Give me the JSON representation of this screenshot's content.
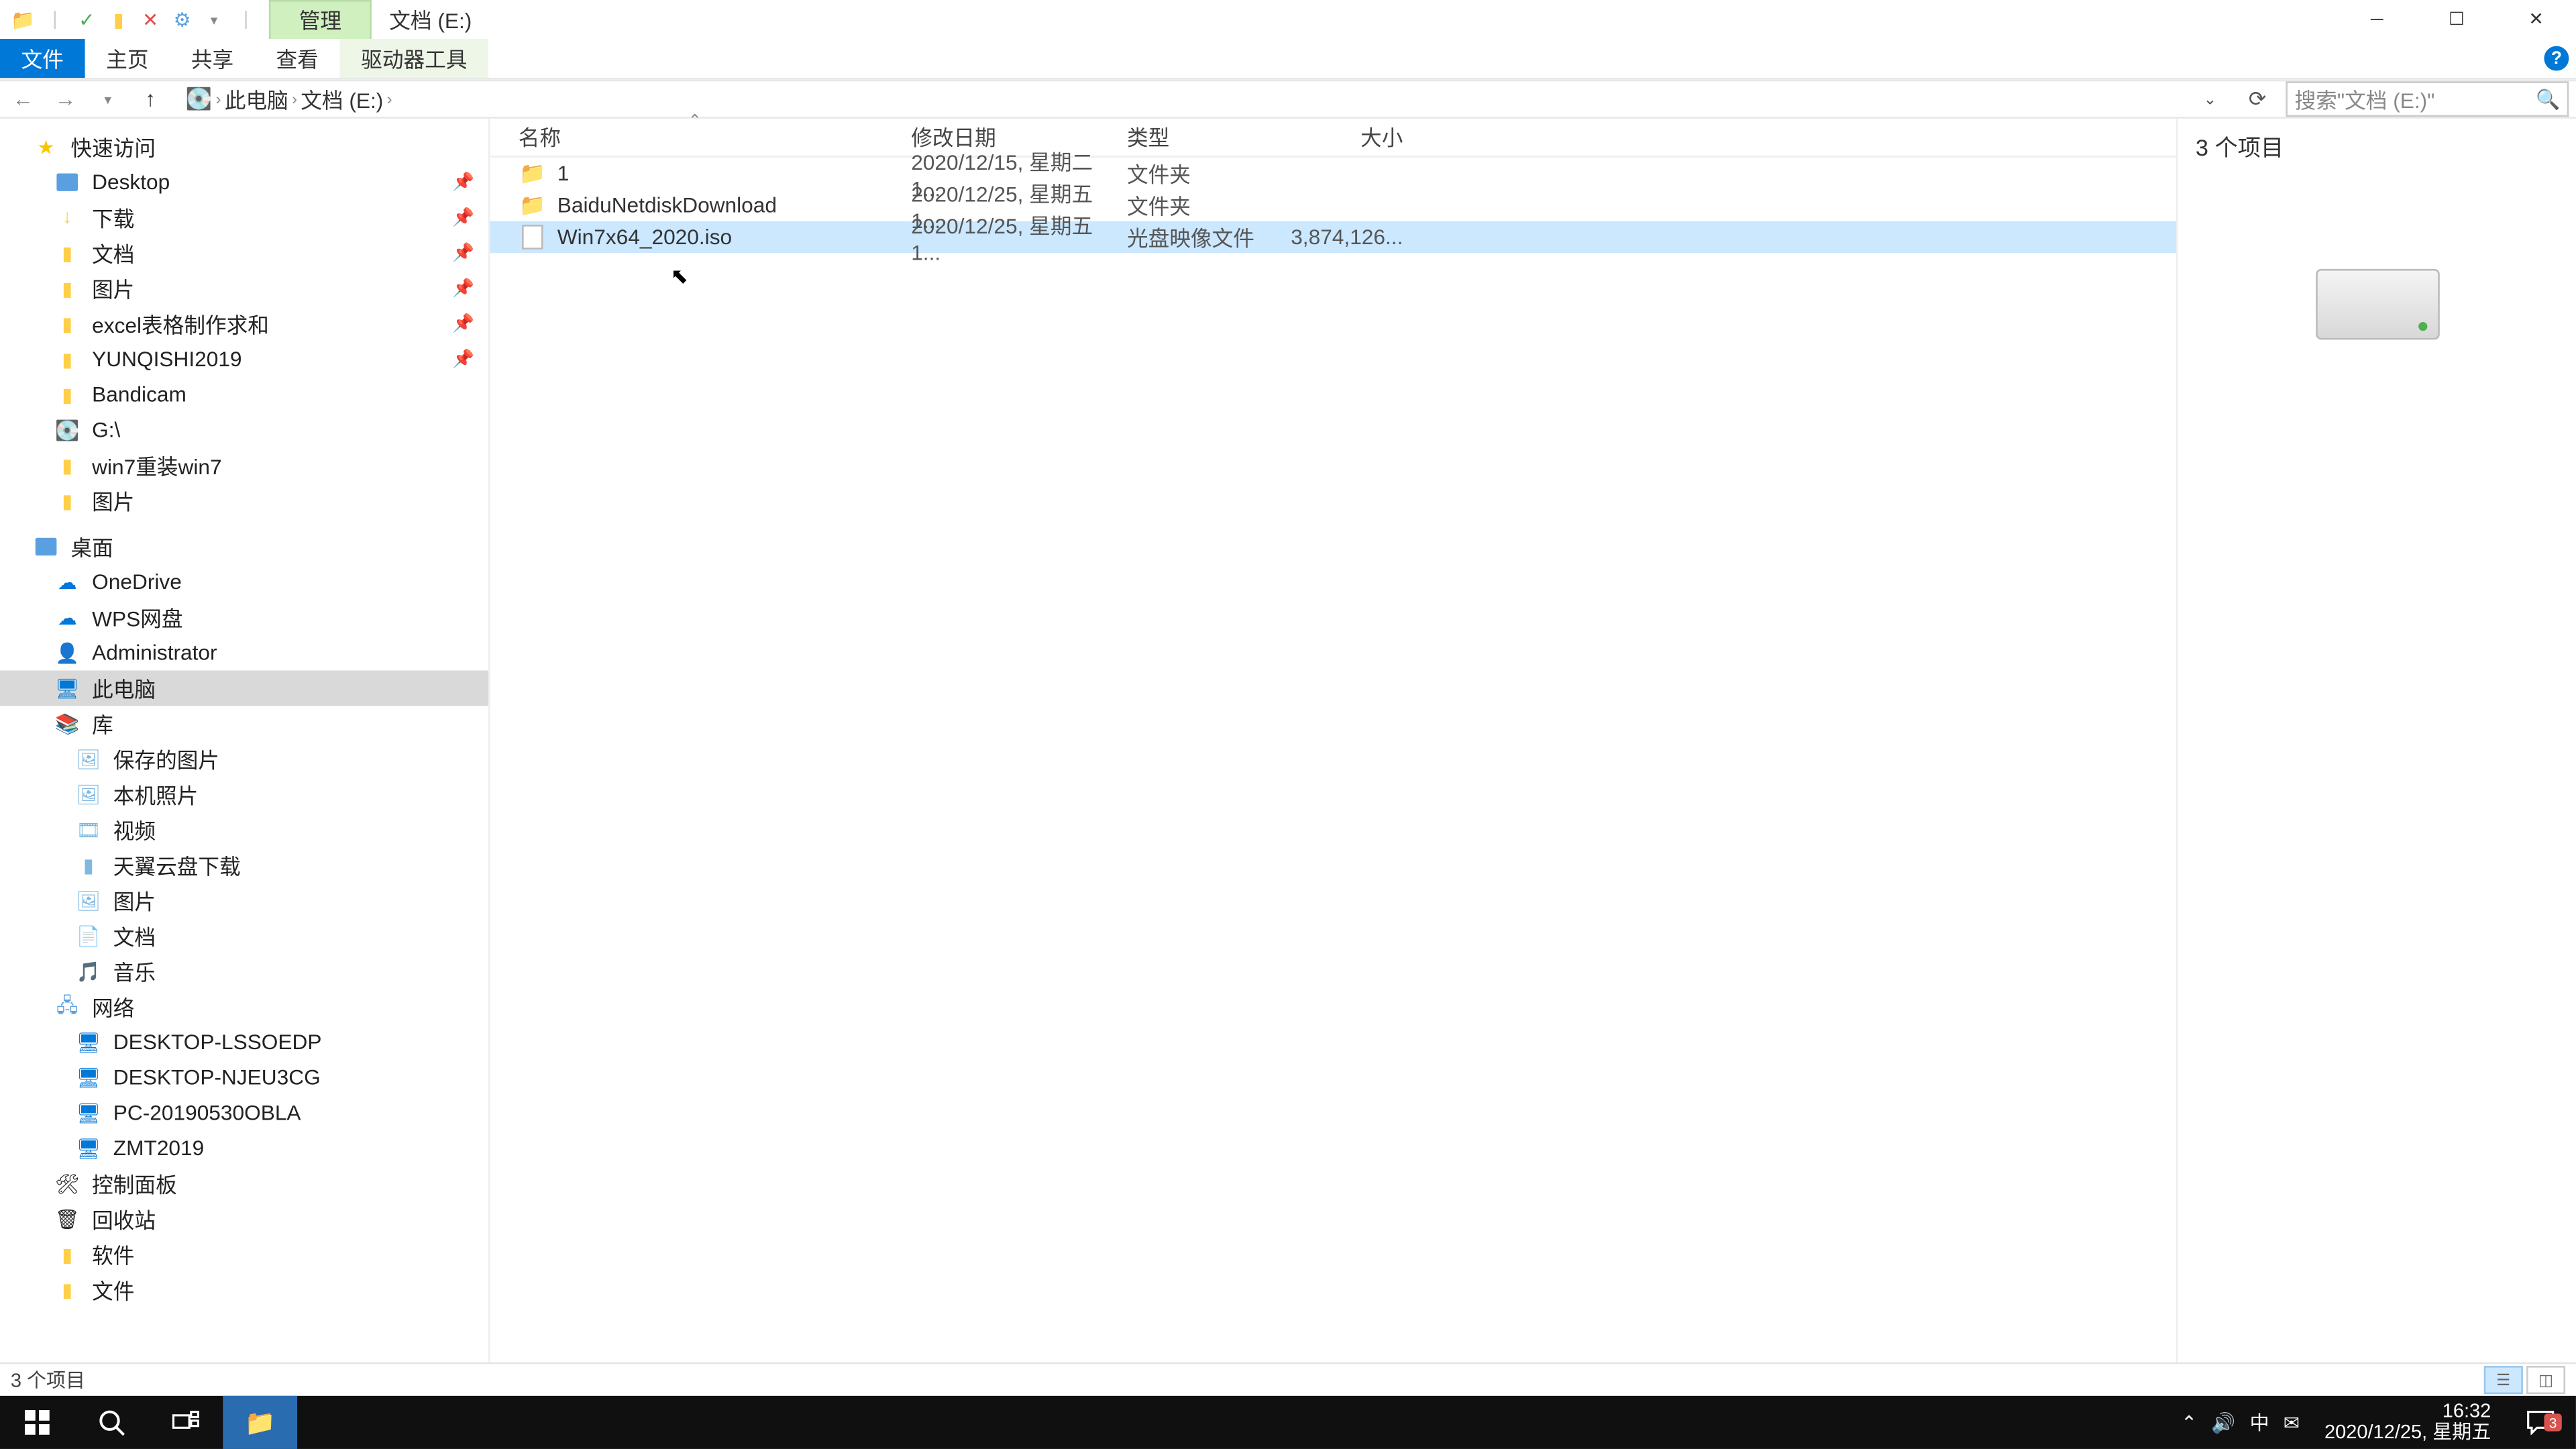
{
  "title": {
    "management_tab": "管理",
    "window_title": "文档 (E:)"
  },
  "ribbon": {
    "file": "文件",
    "home": "主页",
    "share": "共享",
    "view": "查看",
    "driver_tools": "驱动器工具"
  },
  "breadcrumb": {
    "root": "此电脑",
    "current": "文档 (E:)"
  },
  "search": {
    "placeholder": "搜索\"文档 (E:)\""
  },
  "sidebar": {
    "quick_access": "快速访问",
    "desktop": "Desktop",
    "downloads": "下载",
    "documents": "文档",
    "pictures": "图片",
    "excel": "excel表格制作求和",
    "yunqi": "YUNQISHI2019",
    "bandicam": "Bandicam",
    "g_drive": "G:\\",
    "win7": "win7重装win7",
    "pictures2": "图片",
    "desktop2": "桌面",
    "onedrive": "OneDrive",
    "wpspan": "WPS网盘",
    "admin": "Administrator",
    "this_pc": "此电脑",
    "library": "库",
    "saved_pics": "保存的图片",
    "camera_roll": "本机照片",
    "video": "视频",
    "tianyi": "天翼云盘下载",
    "pictures3": "图片",
    "documents3": "文档",
    "music": "音乐",
    "network": "网络",
    "pc1": "DESKTOP-LSSOEDP",
    "pc2": "DESKTOP-NJEU3CG",
    "pc3": "PC-20190530OBLA",
    "pc4": "ZMT2019",
    "control_panel": "控制面板",
    "recycle": "回收站",
    "software": "软件",
    "file": "文件"
  },
  "columns": {
    "name": "名称",
    "date": "修改日期",
    "type": "类型",
    "size": "大小"
  },
  "files": [
    {
      "name": "1",
      "date": "2020/12/15, 星期二 1...",
      "type": "文件夹",
      "size": "",
      "icon": "folder"
    },
    {
      "name": "BaiduNetdiskDownload",
      "date": "2020/12/25, 星期五 1...",
      "type": "文件夹",
      "size": "",
      "icon": "folder"
    },
    {
      "name": "Win7x64_2020.iso",
      "date": "2020/12/25, 星期五 1...",
      "type": "光盘映像文件",
      "size": "3,874,126...",
      "icon": "iso",
      "selected": true
    }
  ],
  "preview": {
    "item_count": "3 个项目"
  },
  "status": {
    "text": "3 个项目"
  },
  "taskbar": {
    "time": "16:32",
    "date": "2020/12/25, 星期五",
    "ime": "中",
    "badge": "3"
  }
}
